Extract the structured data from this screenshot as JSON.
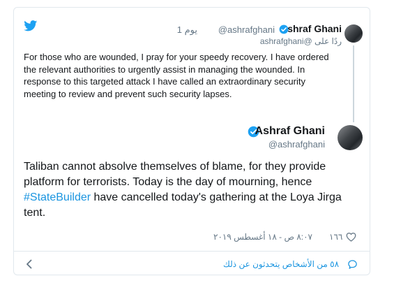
{
  "tweet1": {
    "name": "Ashraf Ghani",
    "handle": "@ashrafghani",
    "time": "1 يوم",
    "reply_to": "ردًا على @ashrafghani",
    "text": "For those who are wounded, I pray for your speedy recovery. I have ordered the relevant authorities to urgently assist in managing the wounded. In response to this targeted attack I have called an extraordinary security meeting to review and prevent such security lapses."
  },
  "tweet2": {
    "name": "Ashraf Ghani",
    "handle": "@ashrafghani",
    "text_before": "Taliban cannot absolve themselves of blame, for they provide platform for terrorists. Today is the day of mourning, hence ",
    "hashtag": "#StateBuilder",
    "text_after": " have cancelled today's gathering at the Loya Jirga tent.",
    "like_count": "١٦٦",
    "timestamp": "٨:٠٧ ص - ١٨ أغسطس ٢٠١٩"
  },
  "footer": {
    "people_talking": "٥٨ من الأشخاص يتحدثون عن ذلك"
  },
  "colors": {
    "twitter_blue": "#1da1f2",
    "link_blue": "#1b95e0",
    "muted_gray": "#657786",
    "text_dark": "#14171a",
    "border": "#e1e8ed"
  },
  "icons": [
    "twitter-logo-icon",
    "verified-badge-icon",
    "heart-icon",
    "chevron-left-icon",
    "speech-bubble-icon"
  ]
}
